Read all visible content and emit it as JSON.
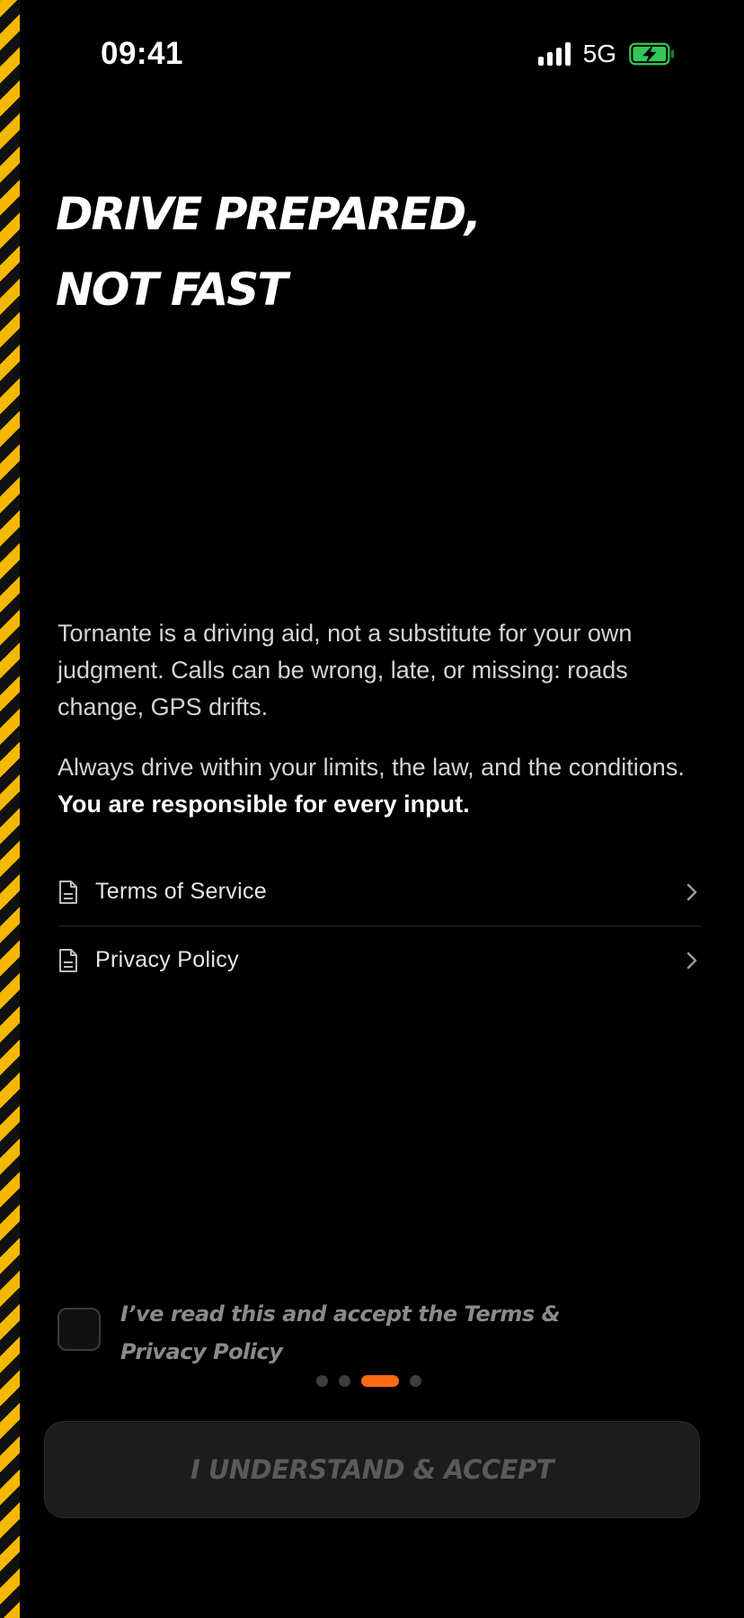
{
  "status_bar": {
    "time": "09:41",
    "network": "5G",
    "battery_color": "#34c759"
  },
  "theme": {
    "accent": "#ff6a13",
    "hazard_yellow": "#f5b800"
  },
  "headline": {
    "line1": "DRIVE PREPARED,",
    "line2": "NOT FAST"
  },
  "body": {
    "paragraph1": "Tornante is a driving aid, not a substitute for your own judgment. Calls can be wrong, late, or missing: roads change, GPS drifts.",
    "paragraph2_plain": "Always drive within your limits, the law, and the conditions. ",
    "paragraph2_bold": "You are responsible for every input."
  },
  "links": [
    {
      "label": "Terms of Service",
      "icon": "document-icon"
    },
    {
      "label": "Privacy Policy",
      "icon": "document-icon"
    }
  ],
  "consent": {
    "text": "I’ve read this and accept the Terms & Privacy Policy",
    "checked": false
  },
  "pager": {
    "total": 4,
    "current": 3
  },
  "accept_button": {
    "label": "I UNDERSTAND & ACCEPT",
    "enabled": false
  }
}
